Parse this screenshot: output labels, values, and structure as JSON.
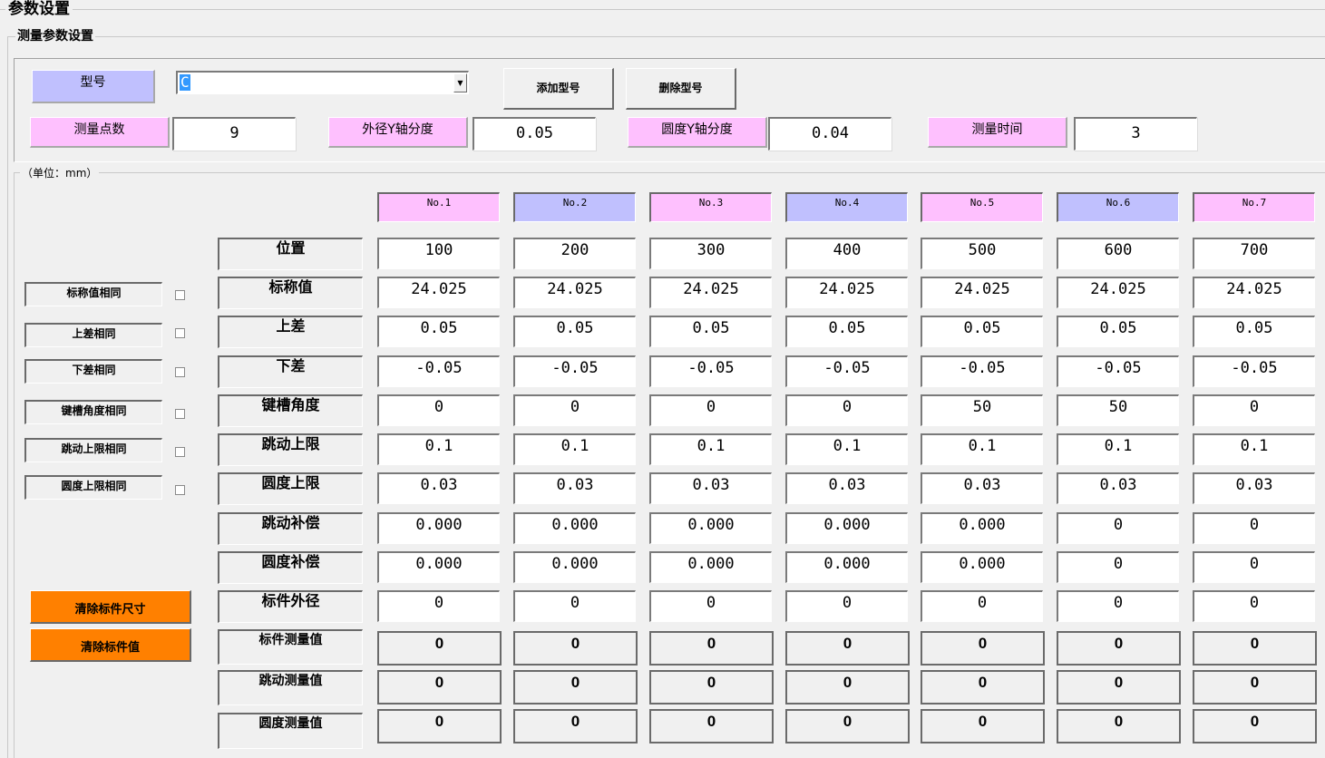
{
  "title": "参数设置",
  "group_title": "测量参数设置",
  "unit_label": "（单位：mm）",
  "model": {
    "label": "型号",
    "value": "C"
  },
  "buttons": {
    "add_model": "添加型号",
    "delete_model": "删除型号"
  },
  "settings": [
    {
      "label": "测量点数",
      "value": "9"
    },
    {
      "label": "外径Y轴分度",
      "value": "0.05"
    },
    {
      "label": "圆度Y轴分度",
      "value": "0.04"
    },
    {
      "label": "测量时间",
      "value": "3"
    }
  ],
  "same_options": [
    {
      "label": "标称值相同",
      "checked": false
    },
    {
      "label": "上差相同",
      "checked": false
    },
    {
      "label": "下差相同",
      "checked": false
    },
    {
      "label": "键槽角度相同",
      "checked": false
    },
    {
      "label": "跳动上限相同",
      "checked": false
    },
    {
      "label": "圆度上限相同",
      "checked": false
    }
  ],
  "action_buttons": {
    "clear_size": "清除标件尺寸",
    "clear_value": "清除标件值"
  },
  "columns": [
    "No.1",
    "No.2",
    "No.3",
    "No.4",
    "No.5",
    "No.6",
    "No.7"
  ],
  "column_colors": [
    "#fec0fe",
    "#c0c0fe",
    "#fec0fe",
    "#c0c0fe",
    "#fec0fe",
    "#c0c0fe",
    "#fec0fe"
  ],
  "rows": [
    {
      "label": "位置",
      "values": [
        "100",
        "200",
        "300",
        "400",
        "500",
        "600",
        "700"
      ]
    },
    {
      "label": "标称值",
      "values": [
        "24.025",
        "24.025",
        "24.025",
        "24.025",
        "24.025",
        "24.025",
        "24.025"
      ]
    },
    {
      "label": "上差",
      "values": [
        "0.05",
        "0.05",
        "0.05",
        "0.05",
        "0.05",
        "0.05",
        "0.05"
      ]
    },
    {
      "label": "下差",
      "values": [
        "-0.05",
        "-0.05",
        "-0.05",
        "-0.05",
        "-0.05",
        "-0.05",
        "-0.05"
      ]
    },
    {
      "label": "键槽角度",
      "values": [
        "0",
        "0",
        "0",
        "0",
        "50",
        "50",
        "0"
      ]
    },
    {
      "label": "跳动上限",
      "values": [
        "0.1",
        "0.1",
        "0.1",
        "0.1",
        "0.1",
        "0.1",
        "0.1"
      ]
    },
    {
      "label": "圆度上限",
      "values": [
        "0.03",
        "0.03",
        "0.03",
        "0.03",
        "0.03",
        "0.03",
        "0.03"
      ]
    },
    {
      "label": "跳动补偿",
      "values": [
        "0.000",
        "0.000",
        "0.000",
        "0.000",
        "0.000",
        "0",
        "0"
      ]
    },
    {
      "label": "圆度补偿",
      "values": [
        "0.000",
        "0.000",
        "0.000",
        "0.000",
        "0.000",
        "0",
        "0"
      ]
    },
    {
      "label": "标件外径",
      "values": [
        "0",
        "0",
        "0",
        "0",
        "0",
        "0",
        "0"
      ]
    }
  ],
  "measured_rows": [
    {
      "label": "标件测量值",
      "values": [
        "0",
        "0",
        "0",
        "0",
        "0",
        "0",
        "0"
      ]
    },
    {
      "label": "跳动测量值",
      "values": [
        "0",
        "0",
        "0",
        "0",
        "0",
        "0",
        "0"
      ]
    },
    {
      "label": "圆度测量值",
      "values": [
        "0",
        "0",
        "0",
        "0",
        "0",
        "0",
        "0"
      ]
    }
  ]
}
